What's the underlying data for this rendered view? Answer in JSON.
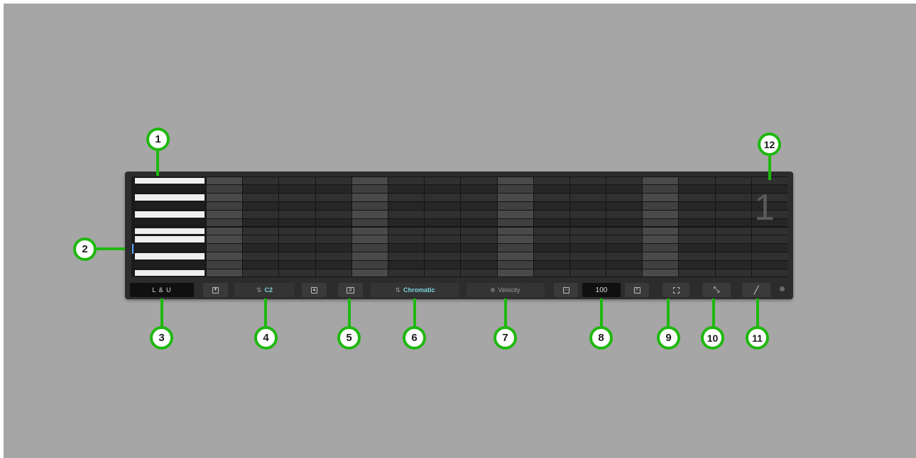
{
  "toolbar": {
    "layout_label": "L & U",
    "octave_down_icon": "arrow-down-icon",
    "root_note": "C2",
    "octave_up_icon": "arrow-up-icon",
    "fold_toggle_icon": "fold-icon",
    "scale": "Chromatic",
    "velocity_label": "Velocity",
    "velocity_value": "100",
    "velocity_decrease_icon": "minus-icon",
    "velocity_increase_icon": "plus-icon",
    "select_tool_icon": "selection-icon",
    "resize_tool_icon": "resize-icon",
    "draw_tool_icon": "pencil-icon"
  },
  "grid": {
    "page_number": "1",
    "columns": 16,
    "rows": 12
  },
  "callouts": [
    "1",
    "2",
    "3",
    "4",
    "5",
    "6",
    "7",
    "8",
    "9",
    "10",
    "11",
    "12"
  ],
  "colors": {
    "background": "#a6a6a6",
    "panel": "#2c2c2c",
    "accent_teal": "#7ad3df",
    "callout_green": "#1fb80f"
  }
}
